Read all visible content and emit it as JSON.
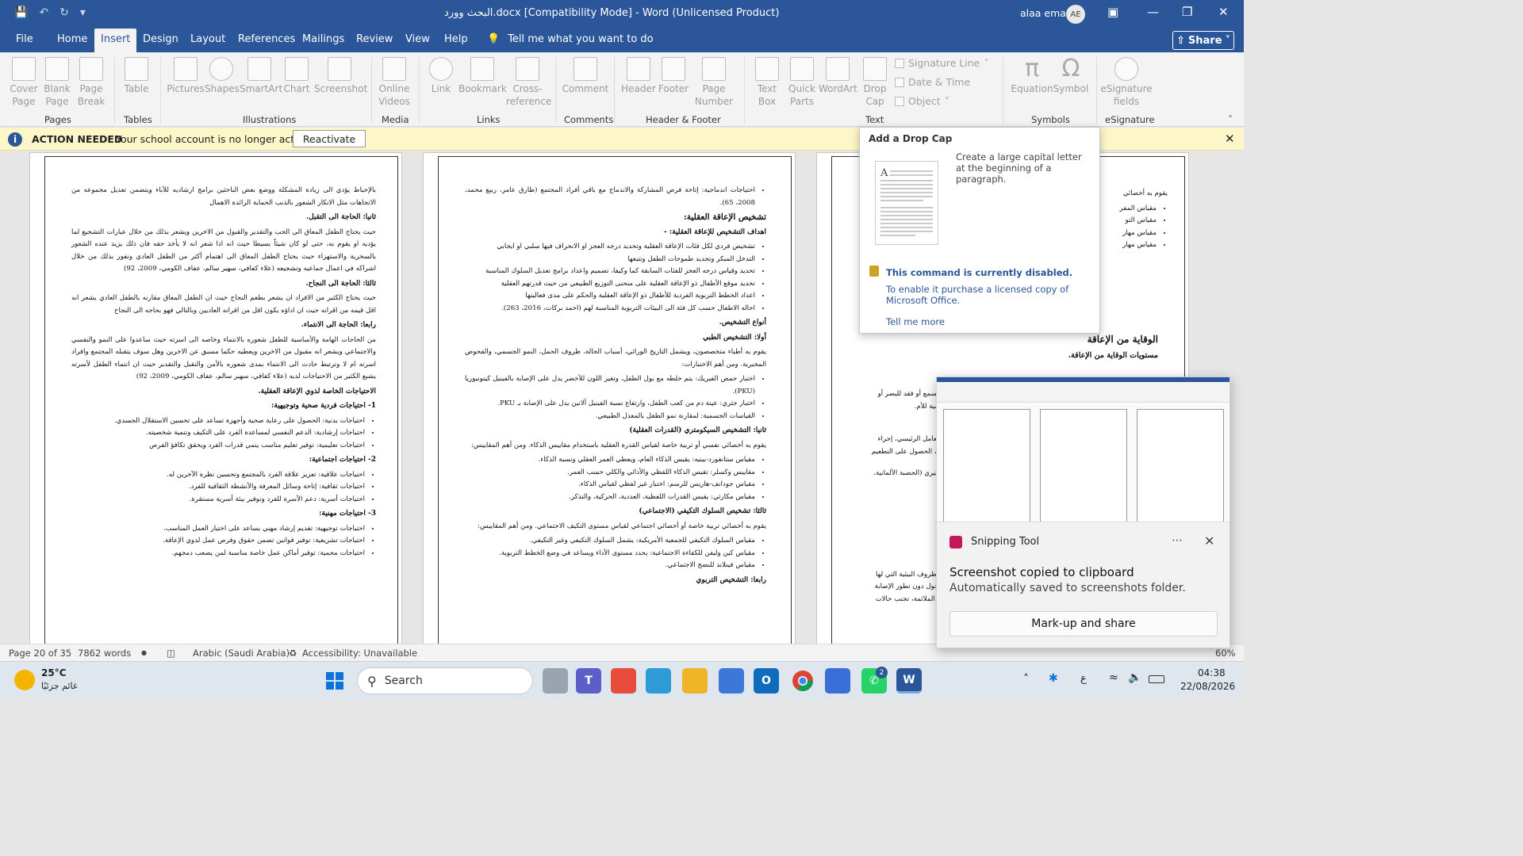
{
  "window": {
    "title": "البحث وورد.docx [Compatibility Mode]  -  Word (Unlicensed Product)",
    "user": "alaa emad",
    "initials": "AE"
  },
  "tabs": [
    "File",
    "Home",
    "Insert",
    "Design",
    "Layout",
    "References",
    "Mailings",
    "Review",
    "View",
    "Help"
  ],
  "active_tab": "Insert",
  "tell_me": "Tell me what you want to do",
  "share": "Share",
  "ribbon": {
    "pages": {
      "group": "Pages",
      "cover": "Cover Page",
      "blank": "Blank Page",
      "break": "Page Break"
    },
    "tables": {
      "group": "Tables",
      "table": "Table"
    },
    "illustrations": {
      "group": "Illustrations",
      "pictures": "Pictures",
      "shapes": "Shapes",
      "smartart": "SmartArt",
      "chart": "Chart",
      "screenshot": "Screenshot"
    },
    "media": {
      "group": "Media",
      "online_videos": "Online Videos"
    },
    "links": {
      "group": "Links",
      "link": "Link",
      "bookmark": "Bookmark",
      "cross": "Cross-reference"
    },
    "comments": {
      "group": "Comments",
      "comment": "Comment"
    },
    "header_footer": {
      "group": "Header & Footer",
      "header": "Header",
      "footer": "Footer",
      "page_number": "Page Number"
    },
    "text": {
      "group": "Text",
      "text_box": "Text Box",
      "quick_parts": "Quick Parts",
      "wordart": "WordArt",
      "drop_cap": "Drop Cap",
      "signature_line": "Signature Line",
      "date_time": "Date & Time",
      "object": "Object"
    },
    "symbols": {
      "group": "Symbols",
      "equation": "Equation",
      "symbol": "Symbol"
    },
    "esignature": {
      "group": "eSignature",
      "fields": "eSignature fields"
    }
  },
  "action_bar": {
    "title": "ACTION NEEDED",
    "message": "Your school account is no longer active.",
    "button": "Reactivate"
  },
  "tooltip": {
    "title": "Add a Drop Cap",
    "description": "Create a large capital letter at the beginning of a paragraph.",
    "disabled": "This command is currently disabled.",
    "enable": "To enable it purchase a licensed copy of Microsoft Office.",
    "more": "Tell me more"
  },
  "page1": {
    "p1": "بالإحباط يؤدي الى زيادة المشكلة ووضع بعض الباحثين برامج ارشاديه للآباء ويتضمن تعديل مجموعه من الاتجاهات مثل الانكار الشعور بالذنب الحماية الزائدة الاهمال",
    "h2": "ثانيا: الحاجة الى التقبل.",
    "p2": "حيث يحتاج الطفل المعاق الى الحب والتقدير والقبول من الاخرين ويشعر بذلك من خلال عبارات التشجيع لما يؤديه او يقوم به، حتى لو كان شيئاً بسيطا حيث انه اذا شعر انه لا يأخذ حقه فان ذلك يزيد عنده الشعور بالسخرية والاستهزاء حيث يحتاج الطفل المعاق الى اهتمام أكثر من الطفل العادي ونفور بذلك من خلال اشراكه في اعمال جماعيه وتشجيعه (علاء كفافي، سهير سالم، عفاف الكومي، 2009، 92)",
    "h3": "ثالثا: الحاجة الى النجاح.",
    "p3": "حيث يحتاج الكثير من الافراد ان يشعر بطعم النجاح حيث ان الطفل المعاق مقارنه بالطفل العادي يشعر انه اقل قيمه من اقرانه حيث ان اداؤه يكون اقل من اقرانه العاديين وبالتالي فهو بحاجه الى النجاح",
    "h4": "رابعا: الحاجة الى الانتماء.",
    "p4": "من الحاجات الهامة والأساسية للطفل شعوره بالانتماء وخاصه الى اسرته حيث ساعدوا على النمو والنفسي والاجتماعي ويشعر انه مقبول من الاخرين ويعطيه حكما مسبق عن الاخرين وهل سوف يتقبله المجتمع وافراد اسرته ام لا وترتبط حادث الى الانتماء بمدى شعوره بالأمن والتقبل والتقدير حيث ان انتماء الطفل لأسرته يشبع الكثير من الاحتياجات لديه (علاء كفافي، سهير سالم، عفاف الكومي، 2009، 92)",
    "h5": "الاحتياجات الخاصة لذوي الإعاقة العقلية.",
    "h6": "1- احتياجات فردية صحية وتوجيهية:",
    "l6": [
      "احتياجات بدنية: الحصول على رعاية صحية وأجهزة تساعد على تحسين الاستقلال الجسدي.",
      "احتياجات إرشادية: الدعم النفسي لمساعدة الفرد على التكيف وتنمية شخصيته.",
      "احتياجات تعليمية: توفير تعليم مناسب ينمي قدرات الفرد ويحقق تكافؤ الفرص"
    ],
    "h7": "2- احتياجات اجتماعية:",
    "l7": [
      "احتياجات علاقية: تعزيز علاقة الفرد بالمجتمع وتحسين نظرة الآخرين له.",
      "احتياجات ثقافية: إتاحة وسائل المعرفة والأنشطة الثقافية للفرد.",
      "احتياجات أسرية: دعم الأسرة للفرد وتوفير بيئة أسرية مستقرة."
    ],
    "h8": "3- احتياجات مهنية:",
    "l8": [
      "احتياجات توجيهية: تقديم إرشاد مهني يساعد على اختيار العمل المناسب.",
      "احتياجات تشريعية: توفير قوانين تضمن حقوق وفرص عمل لذوي الإعاقة.",
      "احتياجات محمية: توفير أماكن عمل خاصة مناسبة لمن يصعب دمجهم."
    ]
  },
  "page2": {
    "l0": [
      "احتياجات اندماجية: إتاحة فرص المشاركة والاندماج مع باقي أفراد المجتمع (طارق عامر، ربيع محمد، 2008، 65)."
    ],
    "h1": "تشخيص الإعاقة العقلية:",
    "h2": "اهداف التشخيص للإعاقة العقلية: -",
    "l2": [
      "تشخيص فردي لكل فئات الإعاقة العقلية وتحديد درجه العجز او الانحراف فيها سلبي او ايجابي",
      "التدخل المبكر وتحديد طموحات الطفل وتتبعها",
      "تحديد وقياس درجه العجز للفئات السابقة كما وكيفا، تصميم واعداد برامج تعديل السلوك المناسبة",
      "تحديد موقع الأطفال ذو الإعاقة العقلية على منحنى التوزيع الطبيعي من حيث قدرتهم العقلية",
      "اعداد الخطط التربوية الفردية للأطفال ذو الإعاقة العقلية والحكم على مدى فعاليتها",
      "احاله الاطفال حسب كل فئة الى البيئات التربوية المناسبة لهم (احمد بركات، 2016، 263)."
    ],
    "h3": "أنواع التشخيص.",
    "h4": "أولا: التشخيص الطبي",
    "p4": "يقوم به أطباء متخصصون، ويشمل التاريخ الوراثي، أسباب الحالة، ظروف الحمل، النمو الجسمي، والفحوص المخبرية. ومن أهم الاختبارات:",
    "l4": [
      "اختبار حمض الفيريك: يتم خلطه مع بول الطفل، وتغير اللون للأخضر يدل على الإصابة بالفينيل كيتونيوريا (PKU).",
      "اختبار جثري: عينة دم من كعب الطفل، وارتفاع نسبة الفينيل ألانين يدل على الإصابة بـ PKU.",
      "القياسات الجسمية: لمقارنة نمو الطفل بالمعدل الطبيعي."
    ],
    "h5": "ثانيا: التشخيص السيكومتري (القدرات العقلية)",
    "p5": "يقوم به أخصائي نفسي أو تربية خاصة لقياس القدرة العقلية باستخدام مقاييس الذكاء. ومن أهم المقاييس:",
    "l5": [
      "مقياس ستانفورد-بينيه: يقيس الذكاء العام، ويعطي العمر العقلي ونسبة الذكاء.",
      "مقاييس وكسلر: تقيس الذكاء اللفظي والأدائي والكلي حسب العمر.",
      "مقياس جودانف-هاريس للرسم: اختبار غير لفظي لقياس الذكاء.",
      "مقياس مكارثي: يقيس القدرات اللفظية، العددية، الحركية، والتذكر."
    ],
    "h6": "ثالثا: تشخيص السلوك التكيفي (الاجتماعي)",
    "p6": "يقوم به أخصائي تربية خاصة أو أخصائي اجتماعي لقياس مستوى التكيف الاجتماعي. ومن أهم المقاييس:",
    "l6": [
      "مقياس السلوك التكيفي للجمعية الأمريكية: يشمل السلوك التكيفي وغير التكيفي.",
      "مقياس كين وليفن للكفاءة الاجتماعية: يحدد مستوى الأداء ويساعد في وضع الخطط التربوية.",
      "مقياس فينلاند للنضج الاجتماعي."
    ],
    "h7": "رابعا: التشخيص التربوي"
  },
  "page3": {
    "p1": "يقوم به أخصائي",
    "l1": [
      "مقياس المفر",
      "مقياس التو",
      "مقياس مهار",
      "مقياس مهار"
    ],
    "h2": "الوقاية من الإعاقة",
    "h3": "مستويات الوقاية من الإعاقة.",
    "frag1": "السمع أو فقد للبصر أو",
    "frag2": "لمية للأم.",
    "frag3": "العامل الرئيسي، إجراء",
    "frag4": "م، الحصول على التطعيم",
    "frag5": "كتيري (الحصبة الألمانية،",
    "frag6": "الظروف البيئية التي لها",
    "frag7": "تحول دون تطور الإصابة",
    "frag8": "ة الملائمة، تجنب حالات"
  },
  "status": {
    "page": "Page 20 of 35",
    "words": "7862 words",
    "language": "Arabic (Saudi Arabia)",
    "accessibility": "Accessibility: Unavailable",
    "zoom": "60%"
  },
  "toast": {
    "app": "Snipping Tool",
    "line1": "Screenshot copied to clipboard",
    "line2": "Automatically saved to screenshots folder.",
    "action": "Mark-up and share"
  },
  "taskbar": {
    "temp": "25°C",
    "weather": "غائم جزئيًا",
    "search": "Search",
    "time": "04:38",
    "date": "22/08/2026",
    "lang": "ع",
    "badge": "2"
  }
}
